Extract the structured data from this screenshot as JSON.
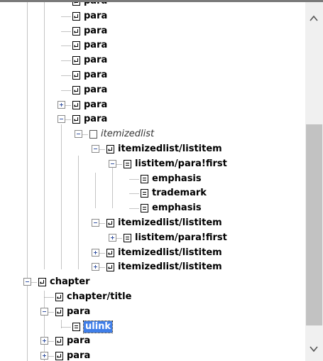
{
  "tree": {
    "nodes": [
      {
        "label": "para",
        "icon": "para-icon",
        "expander": "none",
        "partial": true
      },
      {
        "label": "para",
        "icon": "para-icon",
        "expander": "none"
      },
      {
        "label": "para",
        "icon": "para-icon",
        "expander": "none"
      },
      {
        "label": "para",
        "icon": "para-icon",
        "expander": "none"
      },
      {
        "label": "para",
        "icon": "para-icon",
        "expander": "none"
      },
      {
        "label": "para",
        "icon": "para-icon",
        "expander": "none"
      },
      {
        "label": "para",
        "icon": "para-icon",
        "expander": "none"
      },
      {
        "label": "para",
        "icon": "para-icon",
        "expander": "plus"
      },
      {
        "label": "para",
        "icon": "para-icon",
        "expander": "minus"
      },
      {
        "label": "itemizedlist",
        "icon": "box-icon",
        "expander": "minus",
        "italic": true
      },
      {
        "label": "itemizedlist/listitem",
        "icon": "para-icon",
        "expander": "minus"
      },
      {
        "label": "listitem/para!first",
        "icon": "text-icon",
        "expander": "minus"
      },
      {
        "label": "emphasis",
        "icon": "text-icon",
        "expander": "none"
      },
      {
        "label": "trademark",
        "icon": "text-icon",
        "expander": "none"
      },
      {
        "label": "emphasis",
        "icon": "text-icon",
        "expander": "none"
      },
      {
        "label": "itemizedlist/listitem",
        "icon": "para-icon",
        "expander": "minus"
      },
      {
        "label": "listitem/para!first",
        "icon": "text-icon",
        "expander": "plus"
      },
      {
        "label": "itemizedlist/listitem",
        "icon": "para-icon",
        "expander": "plus"
      },
      {
        "label": "itemizedlist/listitem",
        "icon": "para-icon",
        "expander": "plus"
      },
      {
        "label": "chapter",
        "icon": "para-icon",
        "expander": "minus"
      },
      {
        "label": "chapter/title",
        "icon": "para-icon",
        "expander": "none"
      },
      {
        "label": "para",
        "icon": "para-icon",
        "expander": "minus"
      },
      {
        "label": "ulink",
        "icon": "text-icon",
        "expander": "none",
        "selected": true
      },
      {
        "label": "para",
        "icon": "para-icon",
        "expander": "plus"
      },
      {
        "label": "para",
        "icon": "para-icon",
        "expander": "plus"
      }
    ]
  },
  "scrollbar": {
    "up_icon": "chevron-up-icon",
    "down_icon": "chevron-down-icon",
    "thumb_color": "#c2c2c2"
  },
  "colors": {
    "selection": "#3f7ee8",
    "tree_lines": "#8a8a8a",
    "expander_sign": "#3553a3"
  }
}
